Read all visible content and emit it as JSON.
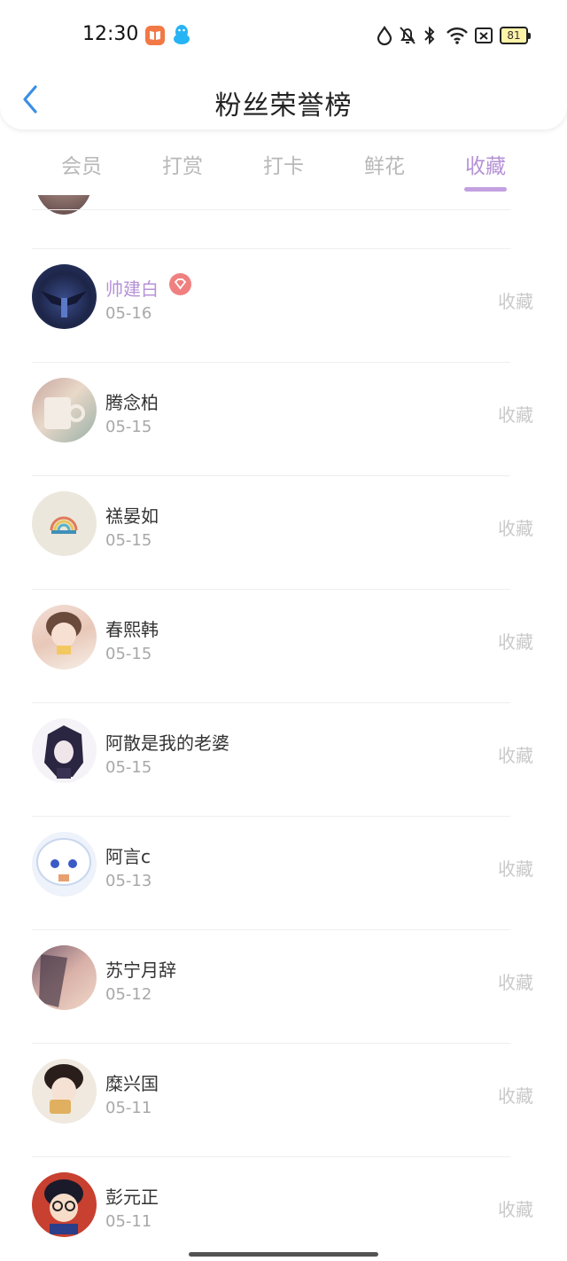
{
  "status_bar": {
    "time": "12:30",
    "battery": "81",
    "icons": [
      "reader-app-icon",
      "qq-app-icon",
      "water-drop-icon",
      "bell-off-icon",
      "bluetooth-icon",
      "wifi-icon",
      "sim-x-icon",
      "battery-icon"
    ]
  },
  "nav": {
    "back_icon": "chevron-left-icon",
    "title": "粉丝荣誉榜"
  },
  "tabs": [
    {
      "label": "会员",
      "active": false
    },
    {
      "label": "打赏",
      "active": false
    },
    {
      "label": "打卡",
      "active": false
    },
    {
      "label": "鲜花",
      "active": false
    },
    {
      "label": "收藏",
      "active": true
    }
  ],
  "colors": {
    "accent": "#b592d6",
    "vip_badge": "#f08080",
    "back_arrow": "#3a8ee6"
  },
  "list": [
    {
      "name": "帅建白",
      "date": "05-16",
      "action": "收藏",
      "vip": true
    },
    {
      "name": "腾念柏",
      "date": "05-15",
      "action": "收藏",
      "vip": false
    },
    {
      "name": "禚晏如",
      "date": "05-15",
      "action": "收藏",
      "vip": false
    },
    {
      "name": "春熙韩",
      "date": "05-15",
      "action": "收藏",
      "vip": false
    },
    {
      "name": "阿散是我的老婆",
      "date": "05-15",
      "action": "收藏",
      "vip": false
    },
    {
      "name": "阿言c",
      "date": "05-13",
      "action": "收藏",
      "vip": false
    },
    {
      "name": "苏宁月辞",
      "date": "05-12",
      "action": "收藏",
      "vip": false
    },
    {
      "name": "糜兴国",
      "date": "05-11",
      "action": "收藏",
      "vip": false
    },
    {
      "name": "彭元正",
      "date": "05-11",
      "action": "收藏",
      "vip": false
    }
  ]
}
